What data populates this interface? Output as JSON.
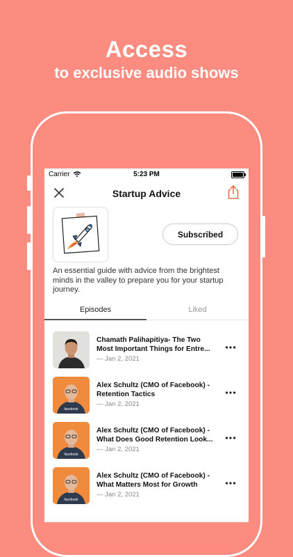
{
  "promo": {
    "title": "Access",
    "subtitle": "to exclusive audio shows"
  },
  "status_bar": {
    "carrier": "Carrier",
    "time": "5:23 PM"
  },
  "nav": {
    "title": "Startup Advice",
    "close_icon": "close-icon",
    "share_icon": "share-icon"
  },
  "podcast": {
    "cover_icon": "rocket-icon",
    "subscribe_label": "Subscribed",
    "description": "An essential guide with advice from the brightest minds in the valley to prepare you for your startup journey."
  },
  "tabs": [
    {
      "label": "Episodes"
    },
    {
      "label": "Liked"
    }
  ],
  "episodes": [
    {
      "title_line1": "Chamath Palihapitiya- The Two",
      "title_line2": "Most Important Things for Entre...",
      "date": "— Jan 2, 2021"
    },
    {
      "title_line1": "Alex Schultz (CMO of Facebook) -",
      "title_line2": "Retention Tactics",
      "date": "— Jan 2, 2021",
      "shirt_text": "facebook"
    },
    {
      "title_line1": "Alex Schultz (CMO of Facebook) -",
      "title_line2": "What Does Good Retention Look...",
      "date": "— Jan 2, 2021",
      "shirt_text": "facebook"
    },
    {
      "title_line1": "Alex Schultz (CMO of Facebook) -",
      "title_line2": "What Matters Most for Growth",
      "date": "— Jan 2, 2021",
      "shirt_text": "facebook"
    }
  ],
  "colors": {
    "background": "#FD8C80",
    "accent": "#F26B4E"
  }
}
